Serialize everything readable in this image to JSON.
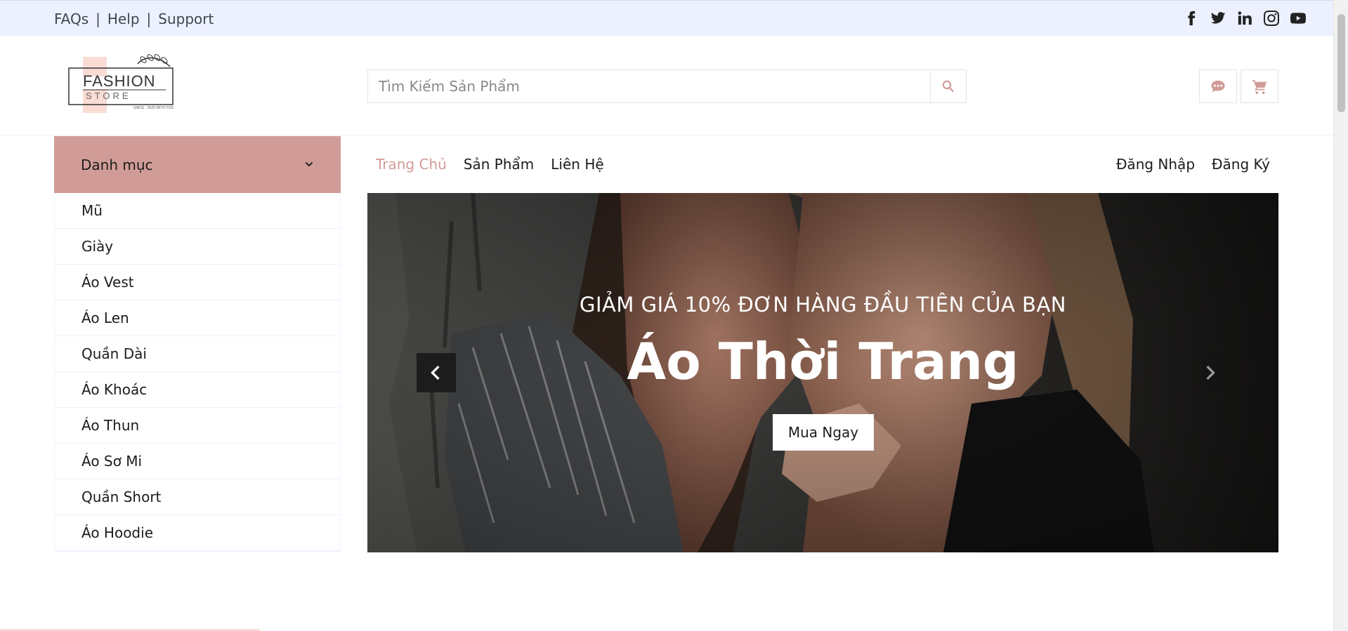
{
  "topbar": {
    "links": [
      "FAQs",
      "Help",
      "Support"
    ],
    "separator": "|",
    "social_icons": [
      "facebook-icon",
      "twitter-icon",
      "linkedin-icon",
      "instagram-icon",
      "youtube-icon"
    ]
  },
  "header": {
    "logo": {
      "line1": "FASHION",
      "line2": "STORE",
      "tagline": "SINCE · 2020 WITH YOU"
    },
    "search": {
      "placeholder": "Tìm Kiếm Sản Phẩm",
      "value": ""
    },
    "icons": [
      "chat-icon",
      "cart-icon"
    ]
  },
  "sidebar": {
    "title": "Danh mục",
    "items": [
      "Mũ",
      "Giày",
      "Áo Vest",
      "Áo Len",
      "Quần Dài",
      "Áo Khoác",
      "Áo Thun",
      "Áo Sơ Mi",
      "Quần Short",
      "Áo Hoodie"
    ]
  },
  "nav": {
    "left": [
      {
        "label": "Trang Chủ",
        "active": true
      },
      {
        "label": "Sản Phẩm",
        "active": false
      },
      {
        "label": "Liên Hệ",
        "active": false
      }
    ],
    "right": [
      "Đăng Nhập",
      "Đăng Ký"
    ]
  },
  "carousel": {
    "subtitle": "GIẢM GIÁ 10% ĐƠN HÀNG ĐẦU TIÊN CỦA BẠN",
    "title": "Áo Thời Trang",
    "button": "Mua Ngay"
  },
  "colors": {
    "primary": "#D19C97",
    "topbar_bg": "#EDF1FF",
    "dark": "#1C1C1C"
  }
}
